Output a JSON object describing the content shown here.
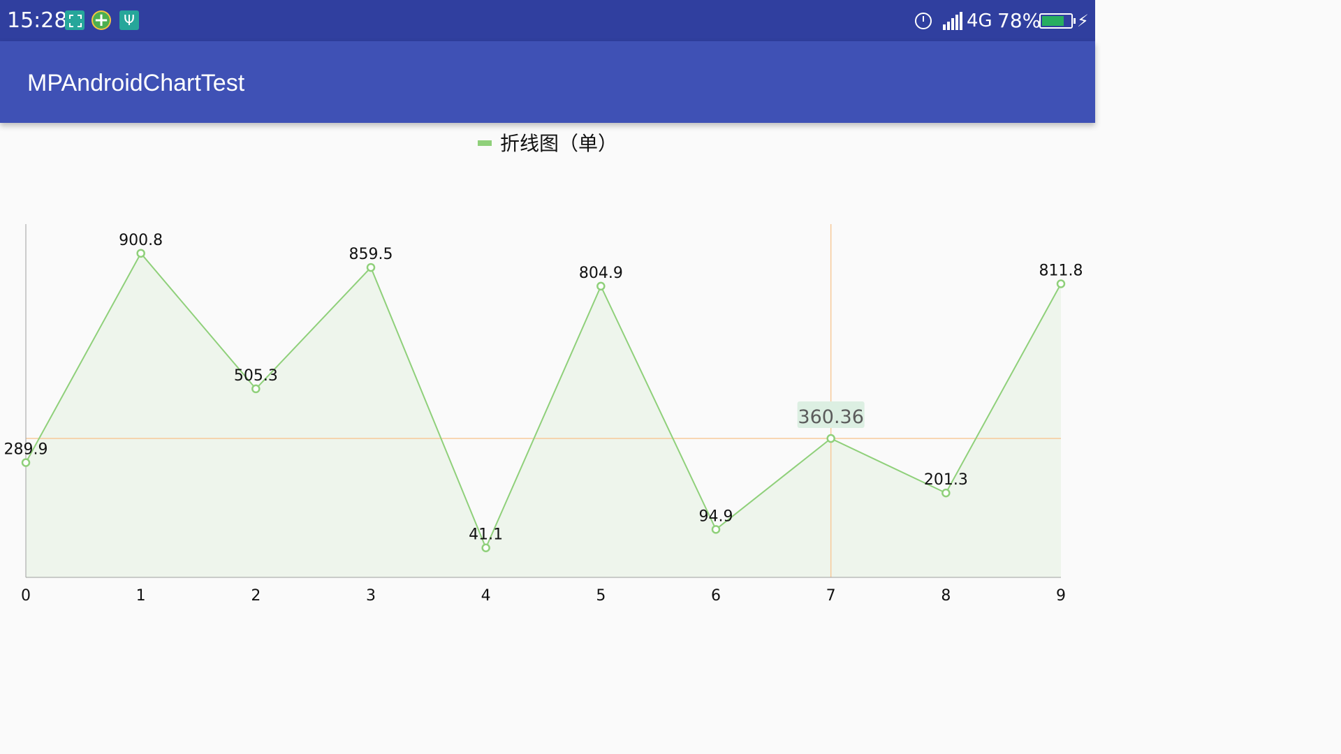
{
  "status_bar": {
    "time": "15:28",
    "network": "4G",
    "battery_percent": "78%",
    "battery_level": 0.78,
    "icons": [
      "screenshot-icon",
      "app-plus-icon",
      "usb-icon",
      "alarm-icon",
      "signal-icon",
      "battery-icon",
      "charging-icon"
    ]
  },
  "app_bar": {
    "title": "MPAndroidChartTest"
  },
  "colors": {
    "status_bar": "#303f9f",
    "app_bar": "#3f51b5",
    "line": "#8fd07a",
    "fill": "#eef5ec",
    "highlight": "#f7c99a",
    "marker_bg": "#dcefe2"
  },
  "chart_data": {
    "type": "line",
    "title": "",
    "xlabel": "",
    "ylabel": "",
    "x": [
      0,
      1,
      2,
      3,
      4,
      5,
      6,
      7,
      8,
      9
    ],
    "series": [
      {
        "name": "折线图（单）",
        "values": [
          289.9,
          900.8,
          505.3,
          859.5,
          41.1,
          804.9,
          94.9,
          360.36,
          201.3,
          811.8
        ],
        "labels": [
          "289.9",
          "900.8",
          "505.3",
          "859.5",
          "41.1",
          "804.9",
          "94.9",
          "",
          "201.3",
          "811.8"
        ],
        "filled": true,
        "circles": true
      }
    ],
    "ylim": [
      -45,
      986
    ],
    "xlim": [
      0,
      9
    ],
    "grid": false,
    "legend": "top-center",
    "highlight": {
      "x": 7,
      "y": 360.36,
      "label": "360.36"
    }
  }
}
